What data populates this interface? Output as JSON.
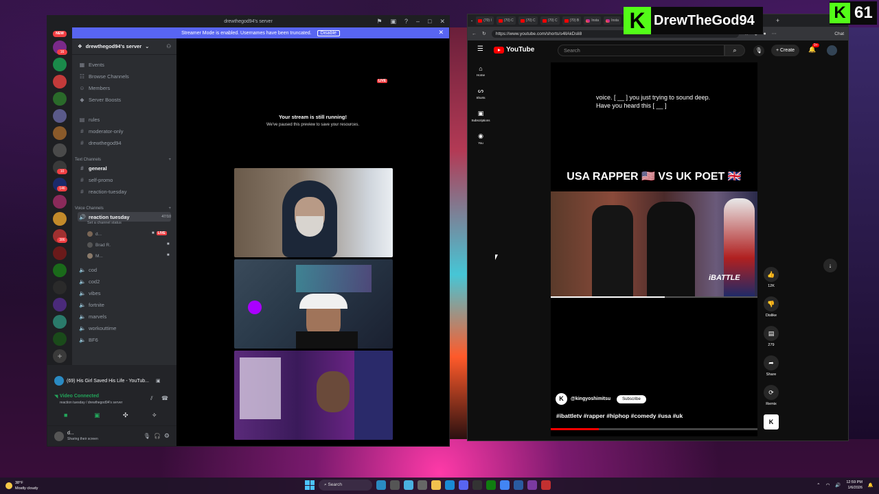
{
  "overlay": {
    "streamer_name": "DrewTheGod94",
    "viewer_count": "61",
    "kick_logo": "K"
  },
  "discord": {
    "window_title": "drewthegod94's server",
    "banner_text": "Streamer Mode is enabled. Usernames have been truncated.",
    "banner_button": "Disable",
    "new_badge": "NEW",
    "server_badges": [
      "16",
      "10",
      "146",
      "386"
    ],
    "server_name": "drewthegod94's server",
    "top_items": [
      "Events",
      "Browse Channels",
      "Members",
      "Server Boosts"
    ],
    "channels_top": [
      "rules",
      "moderator-only",
      "drewthegod94"
    ],
    "text_category": "Text Channels",
    "text_channels": [
      "general",
      "self-promo",
      "reaction-tuesday"
    ],
    "voice_category": "Voice Channels",
    "active_voice": {
      "name": "reaction tuesday",
      "count": "47/10",
      "status": "Set a channel status"
    },
    "voice_members": [
      "d...",
      "Brad R.",
      "M..."
    ],
    "voice_live_label": "LIVE",
    "voice_channels": [
      "cod",
      "cod2",
      "vibes",
      "fortnite",
      "marvels",
      "workouttime",
      "BF6"
    ],
    "activity": "(69) His Girl Saved His Life - YouTub...",
    "video_status": "Video Connected",
    "video_sub": "reaction tuesday / drewthegod94's server",
    "user_name": "d...",
    "user_status": "Sharing their screen",
    "stream_title": "Your stream is still running!",
    "stream_sub": "We've paused this preview to save your resources.",
    "stream_live": "LIVE"
  },
  "browser": {
    "tabs": [
      "(70) I",
      "(70) C",
      "(70) C",
      "(70) C",
      "(70) B",
      "Insta",
      "Insta"
    ],
    "url": "https://www.youtube.com/shorts/s4llAkDsli8",
    "chat_label": "Chat"
  },
  "youtube": {
    "logo": "YouTube",
    "search_placeholder": "Search",
    "create": "Create",
    "notif_count": "9+",
    "sidebar": [
      "Home",
      "Shorts",
      "Subscriptions",
      "You"
    ],
    "caption": "voice. [ __ ] you just trying to sound deep. Have you heard this [ __ ]",
    "short_title": "USA RAPPER 🇺🇸 VS UK POET 🇬🇧",
    "watermark": "iBATTLE",
    "channel": "@kingyoshimitsu",
    "channel_initial": "K",
    "subscribe": "Subscribe",
    "tags": "#ibattletv #rapper #hiphop #comedy #usa #uk",
    "actions": [
      {
        "icon": "like-icon",
        "label": "12K"
      },
      {
        "icon": "dislike-icon",
        "label": "Dislike"
      },
      {
        "icon": "comment-icon",
        "label": "279"
      },
      {
        "icon": "share-icon",
        "label": "Share"
      },
      {
        "icon": "remix-icon",
        "label": "Remix"
      }
    ],
    "progress": 0.55
  },
  "taskbar": {
    "temp": "38°F",
    "weather": "Mostly cloudy",
    "search": "Search",
    "time": "12:59 PM",
    "date": "1/6/2026"
  }
}
